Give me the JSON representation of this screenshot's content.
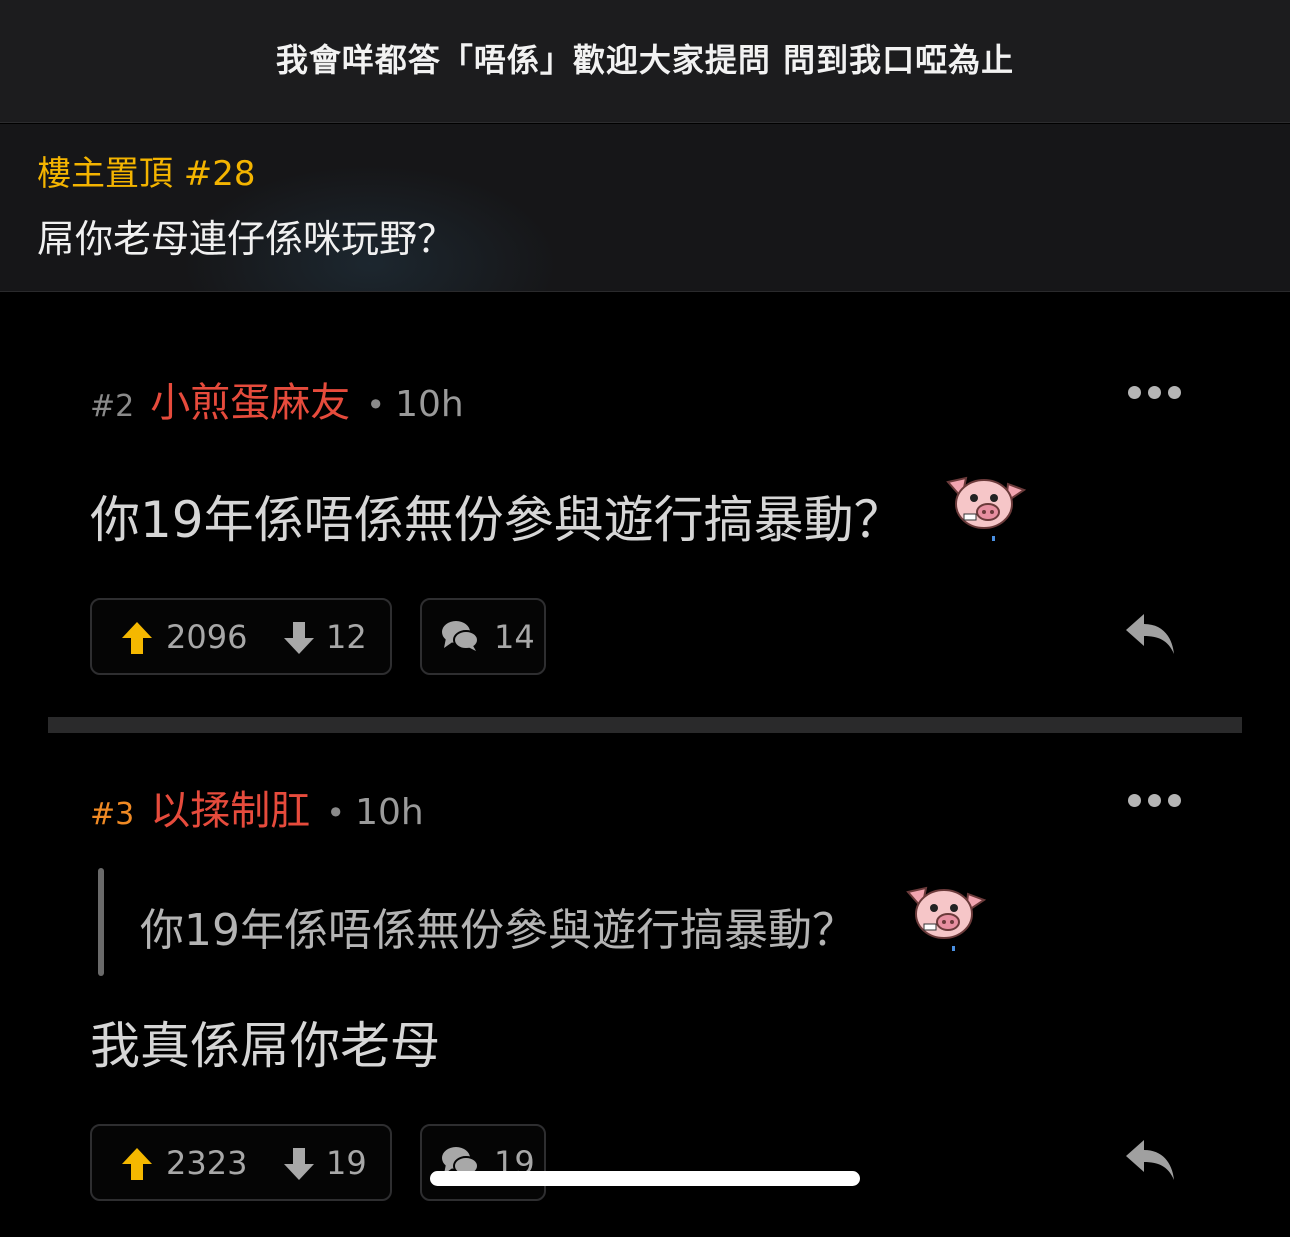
{
  "thread": {
    "title": "我會咩都答「唔係」歡迎大家提問 問到我口啞為止"
  },
  "pinned": {
    "label": "樓主置頂 #28",
    "text": "屌你老母連仔係咪玩野？"
  },
  "posts": [
    {
      "floor": "#2",
      "author": "小煎蛋麻友",
      "separator": "•",
      "time": "10h",
      "body": "你19年係唔係無份參與遊行搞暴動？",
      "emoji": "pig-icon",
      "upvotes": "2096",
      "downvotes": "12",
      "comments": "14"
    },
    {
      "floor": "#3",
      "author": "以揉制肛",
      "separator": "•",
      "time": "10h",
      "quote": "你19年係唔係無份參與遊行搞暴動？",
      "emoji": "pig-icon",
      "body": "我真係屌你老母",
      "upvotes": "2323",
      "downvotes": "19",
      "comments": "19"
    }
  ],
  "colors": {
    "accent_yellow": "#f4b400",
    "author_red": "#e64b3c",
    "op_floor_orange": "#f08a24",
    "upvote_yellow": "#f5b800",
    "background": "#000000",
    "header_bg": "#1c1c1e"
  }
}
